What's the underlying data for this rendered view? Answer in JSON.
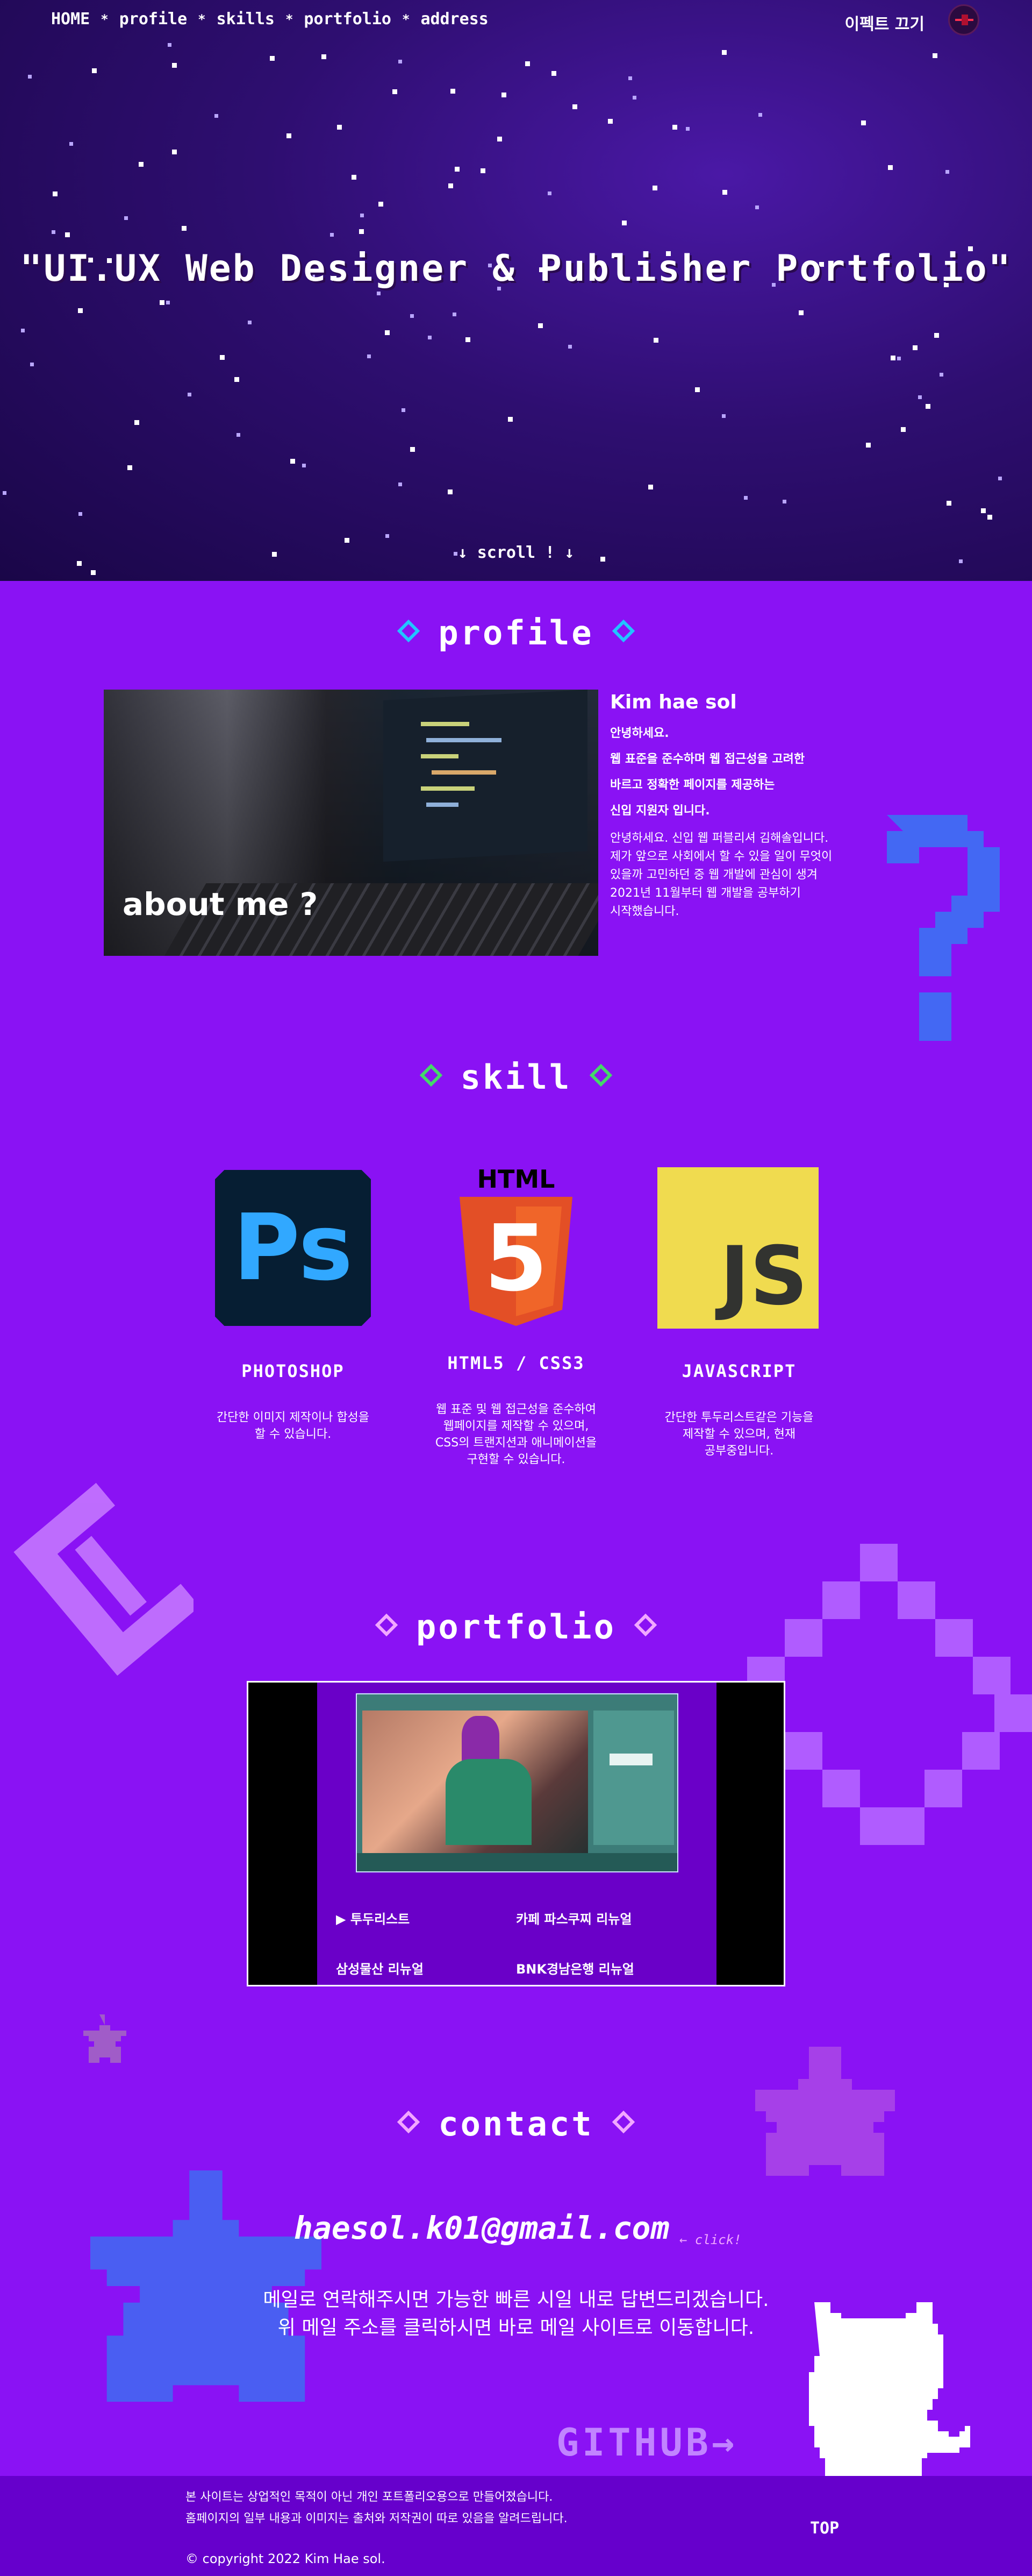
{
  "nav": {
    "items": [
      "HOME",
      "profile",
      "skills",
      "portfolio",
      "address"
    ],
    "separator": "*",
    "effect_toggle": "이펙트 끄기"
  },
  "hero": {
    "title": "\"UI.UX Web Designer & Publisher Portfolio\"",
    "scroll_hint": "↓ scroll ! ↓"
  },
  "profile": {
    "section_title": "profile",
    "image_label": "about me ?",
    "name": "Kim hae sol",
    "intro": [
      "안녕하세요.",
      "웹 표준을 준수하며 웹 접근성을 고려한",
      "바르고 정확한 페이지를 제공하는",
      "신입 지원자 입니다."
    ],
    "description": [
      "안녕하세요. 신입 웹 퍼블리셔 김해솔입니다.",
      "제가 앞으로 사회에서 할 수 있을 일이 무엇이",
      "있을까 고민하던 중 웹 개발에 관심이 생겨",
      "2021년 11월부터 웹 개발을 공부하기",
      "시작했습니다."
    ]
  },
  "skills": {
    "section_title": "skill",
    "items": [
      {
        "name": "PHOTOSHOP",
        "logo_text": "Ps",
        "description": [
          "간단한 이미지 제작이나 합성을",
          "할 수 있습니다."
        ]
      },
      {
        "name": "HTML5 / CSS3",
        "logo_text": "HTML",
        "logo_number": "5",
        "description": [
          "웹 표준 및 웹 접근성을 준수하여",
          "웹페이지를 제작할 수 있으며,",
          "CSS의 트랜지션과 애니메이션을",
          "구현할 수 있습니다."
        ]
      },
      {
        "name": "JAVASCRIPT",
        "logo_text": "JS",
        "description": [
          "간단한 투두리스트같은 기능을",
          "제작할 수 있으며, 현재",
          "공부중입니다."
        ]
      }
    ]
  },
  "portfolio": {
    "section_title": "portfolio",
    "items": [
      "▶ 투두리스트",
      "카페 파스쿠찌 리뉴얼",
      "삼성물산 리뉴얼",
      "BNK경남은행 리뉴얼"
    ]
  },
  "contact": {
    "section_title": "contact",
    "email": "haesol.k01@gmail.com",
    "click_hint": "← click!",
    "message": [
      "메일로 연락해주시면 가능한 빠른 시일 내로 답변드리겠습니다.",
      "위 메일 주소를 클릭하시면 바로 메일 사이트로 이동합니다."
    ],
    "github_label": "GITHUB→"
  },
  "footer": {
    "notes": [
      "본 사이트는 상업적인 목적이 아닌 개인 포트폴리오용으로 만들어졌습니다.",
      "홈페이지의 일부 내용과 이미지는 출처와 저작권이 따로 있음을 알려드립니다."
    ],
    "top_label": "TOP",
    "copyright": "© copyright 2022 Kim Hae sol."
  },
  "colors": {
    "background": "#8a12f4",
    "hero_bg": "#2e0e70",
    "profile_diamond": "#22c4ff",
    "skill_diamond": "#44d86a",
    "portfolio_diamond": "#f2a8ff",
    "contact_diamond": "#f2a8ff",
    "footer_bg": "#6600cc"
  }
}
